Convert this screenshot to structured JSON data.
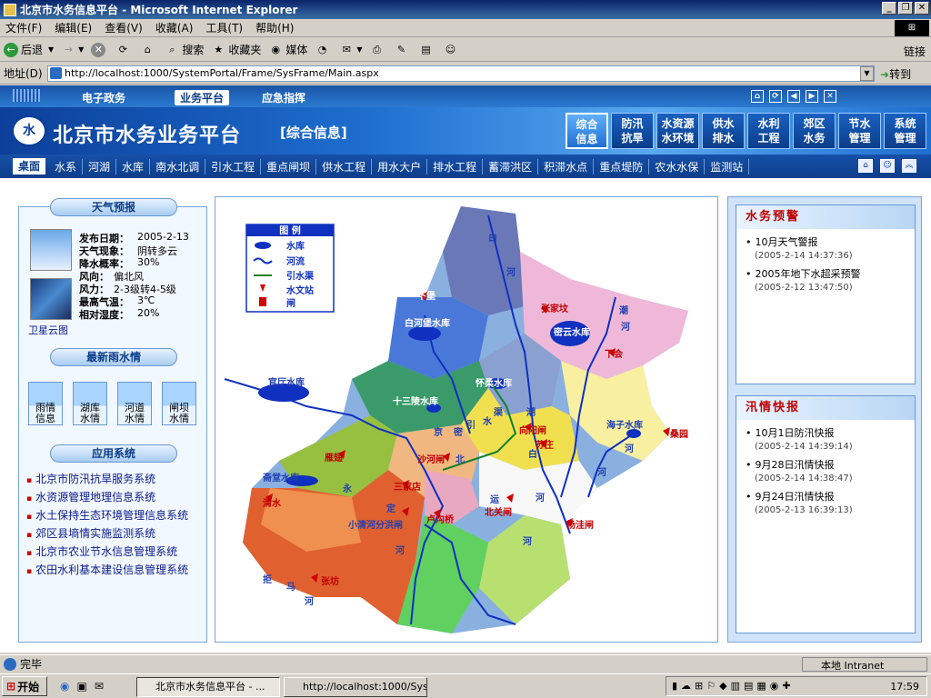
{
  "window": {
    "title": "北京市水务信息平台 - Microsoft Internet Explorer"
  },
  "menu": [
    "文件(F)",
    "编辑(E)",
    "查看(V)",
    "收藏(A)",
    "工具(T)",
    "帮助(H)"
  ],
  "toolbar": {
    "back": "后退",
    "search": "搜索",
    "favorites": "收藏夹",
    "media": "媒体",
    "links": "链接"
  },
  "address": {
    "label": "地址(D)",
    "url": "http://localhost:1000/SystemPortal/Frame/SysFrame/Main.aspx",
    "go": "转到"
  },
  "topnav": {
    "items": [
      "电子政务",
      "业务平台",
      "应急指挥"
    ]
  },
  "banner": {
    "title": "北京市水务业务平台",
    "subtitle": "[综合信息]",
    "logo": "水"
  },
  "modules": [
    {
      "l1": "综合",
      "l2": "信息"
    },
    {
      "l1": "防汛",
      "l2": "抗旱"
    },
    {
      "l1": "水资源",
      "l2": "水环境"
    },
    {
      "l1": "供水",
      "l2": "排水"
    },
    {
      "l1": "水利",
      "l2": "工程"
    },
    {
      "l1": "郊区",
      "l2": "水务"
    },
    {
      "l1": "节水",
      "l2": "管理"
    },
    {
      "l1": "系统",
      "l2": "管理"
    }
  ],
  "categories": [
    "桌面",
    "水系",
    "河湖",
    "水库",
    "南水北调",
    "引水工程",
    "重点闸坝",
    "供水工程",
    "用水大户",
    "排水工程",
    "蓄滞洪区",
    "积滞水点",
    "重点堤防",
    "农水水保",
    "监测站"
  ],
  "weather": {
    "header": "天气预报",
    "satellite": "卫星云图",
    "rows": [
      {
        "label": "发布日期：",
        "value": "2005-2-13"
      },
      {
        "label": "天气现象：",
        "value": "阴转多云"
      },
      {
        "label": "降水概率：",
        "value": "30%"
      },
      {
        "label": "风向：",
        "value": "偏北风"
      },
      {
        "label": "风力：",
        "value": "2-3级转4-5级"
      },
      {
        "label": "最高气温：",
        "value": "3℃"
      },
      {
        "label": "相对湿度：",
        "value": "20%"
      }
    ]
  },
  "rain": {
    "header": "最新雨水情",
    "buttons": [
      {
        "l1": "雨情",
        "l2": "信息"
      },
      {
        "l1": "湖库",
        "l2": "水情"
      },
      {
        "l1": "河道",
        "l2": "水情"
      },
      {
        "l1": "闸坝",
        "l2": "水情"
      }
    ]
  },
  "systems": {
    "header": "应用系统",
    "items": [
      "北京市防汛抗旱服务系统",
      "水资源管理地理信息系统",
      "水土保持生态环境管理信息系统",
      "郊区县墒情实施监测系统",
      "北京市农业节水信息管理系统",
      "农田水利基本建设信息管理系统"
    ]
  },
  "legend": {
    "title": "图 例",
    "items": [
      "水库",
      "河流",
      "引水渠",
      "水文站",
      "闸"
    ]
  },
  "map_labels": [
    "白",
    "河",
    "潮",
    "河",
    "下堡",
    "白河堡水库",
    "张家坟",
    "密云水库",
    "下会",
    "官厅水库",
    "十三陵水库",
    "怀柔水库",
    "京",
    "密",
    "引",
    "水",
    "渠",
    "潮",
    "向阳闸",
    "苏庄",
    "海子水库",
    "桑园",
    "河",
    "河",
    "白",
    "雁翅",
    "斋堂水库",
    "沙河闸",
    "北",
    "永",
    "三家店",
    "运",
    "清水",
    "定",
    "卢沟桥",
    "北关闸",
    "杨洼闸",
    "小清河分洪闸",
    "河",
    "河",
    "河",
    "张坊",
    "拒",
    "马",
    "河"
  ],
  "warnings": {
    "header": "水务预警",
    "items": [
      {
        "title": "10月天气警报",
        "time": "(2005-2-14 14:37:36)"
      },
      {
        "title": "2005年地下水超采预警",
        "time": "(2005-2-12 13:47:50)"
      }
    ]
  },
  "flood": {
    "header": "汛情快报",
    "items": [
      {
        "title": "10月1日防汛快报",
        "time": "(2005-2-14 14:39:14)"
      },
      {
        "title": "9月28日汛情快报",
        "time": "(2005-2-14 14:38:47)"
      },
      {
        "title": "9月24日汛情快报",
        "time": "(2005-2-13 16:39:13)"
      }
    ]
  },
  "status": {
    "text": "完毕",
    "zone": "本地 Intranet"
  },
  "taskbar": {
    "start": "开始",
    "tasks": [
      "北京市水务信息平台 - ...",
      "http://localhost:1000/Sys..."
    ],
    "clock": "17:59"
  }
}
